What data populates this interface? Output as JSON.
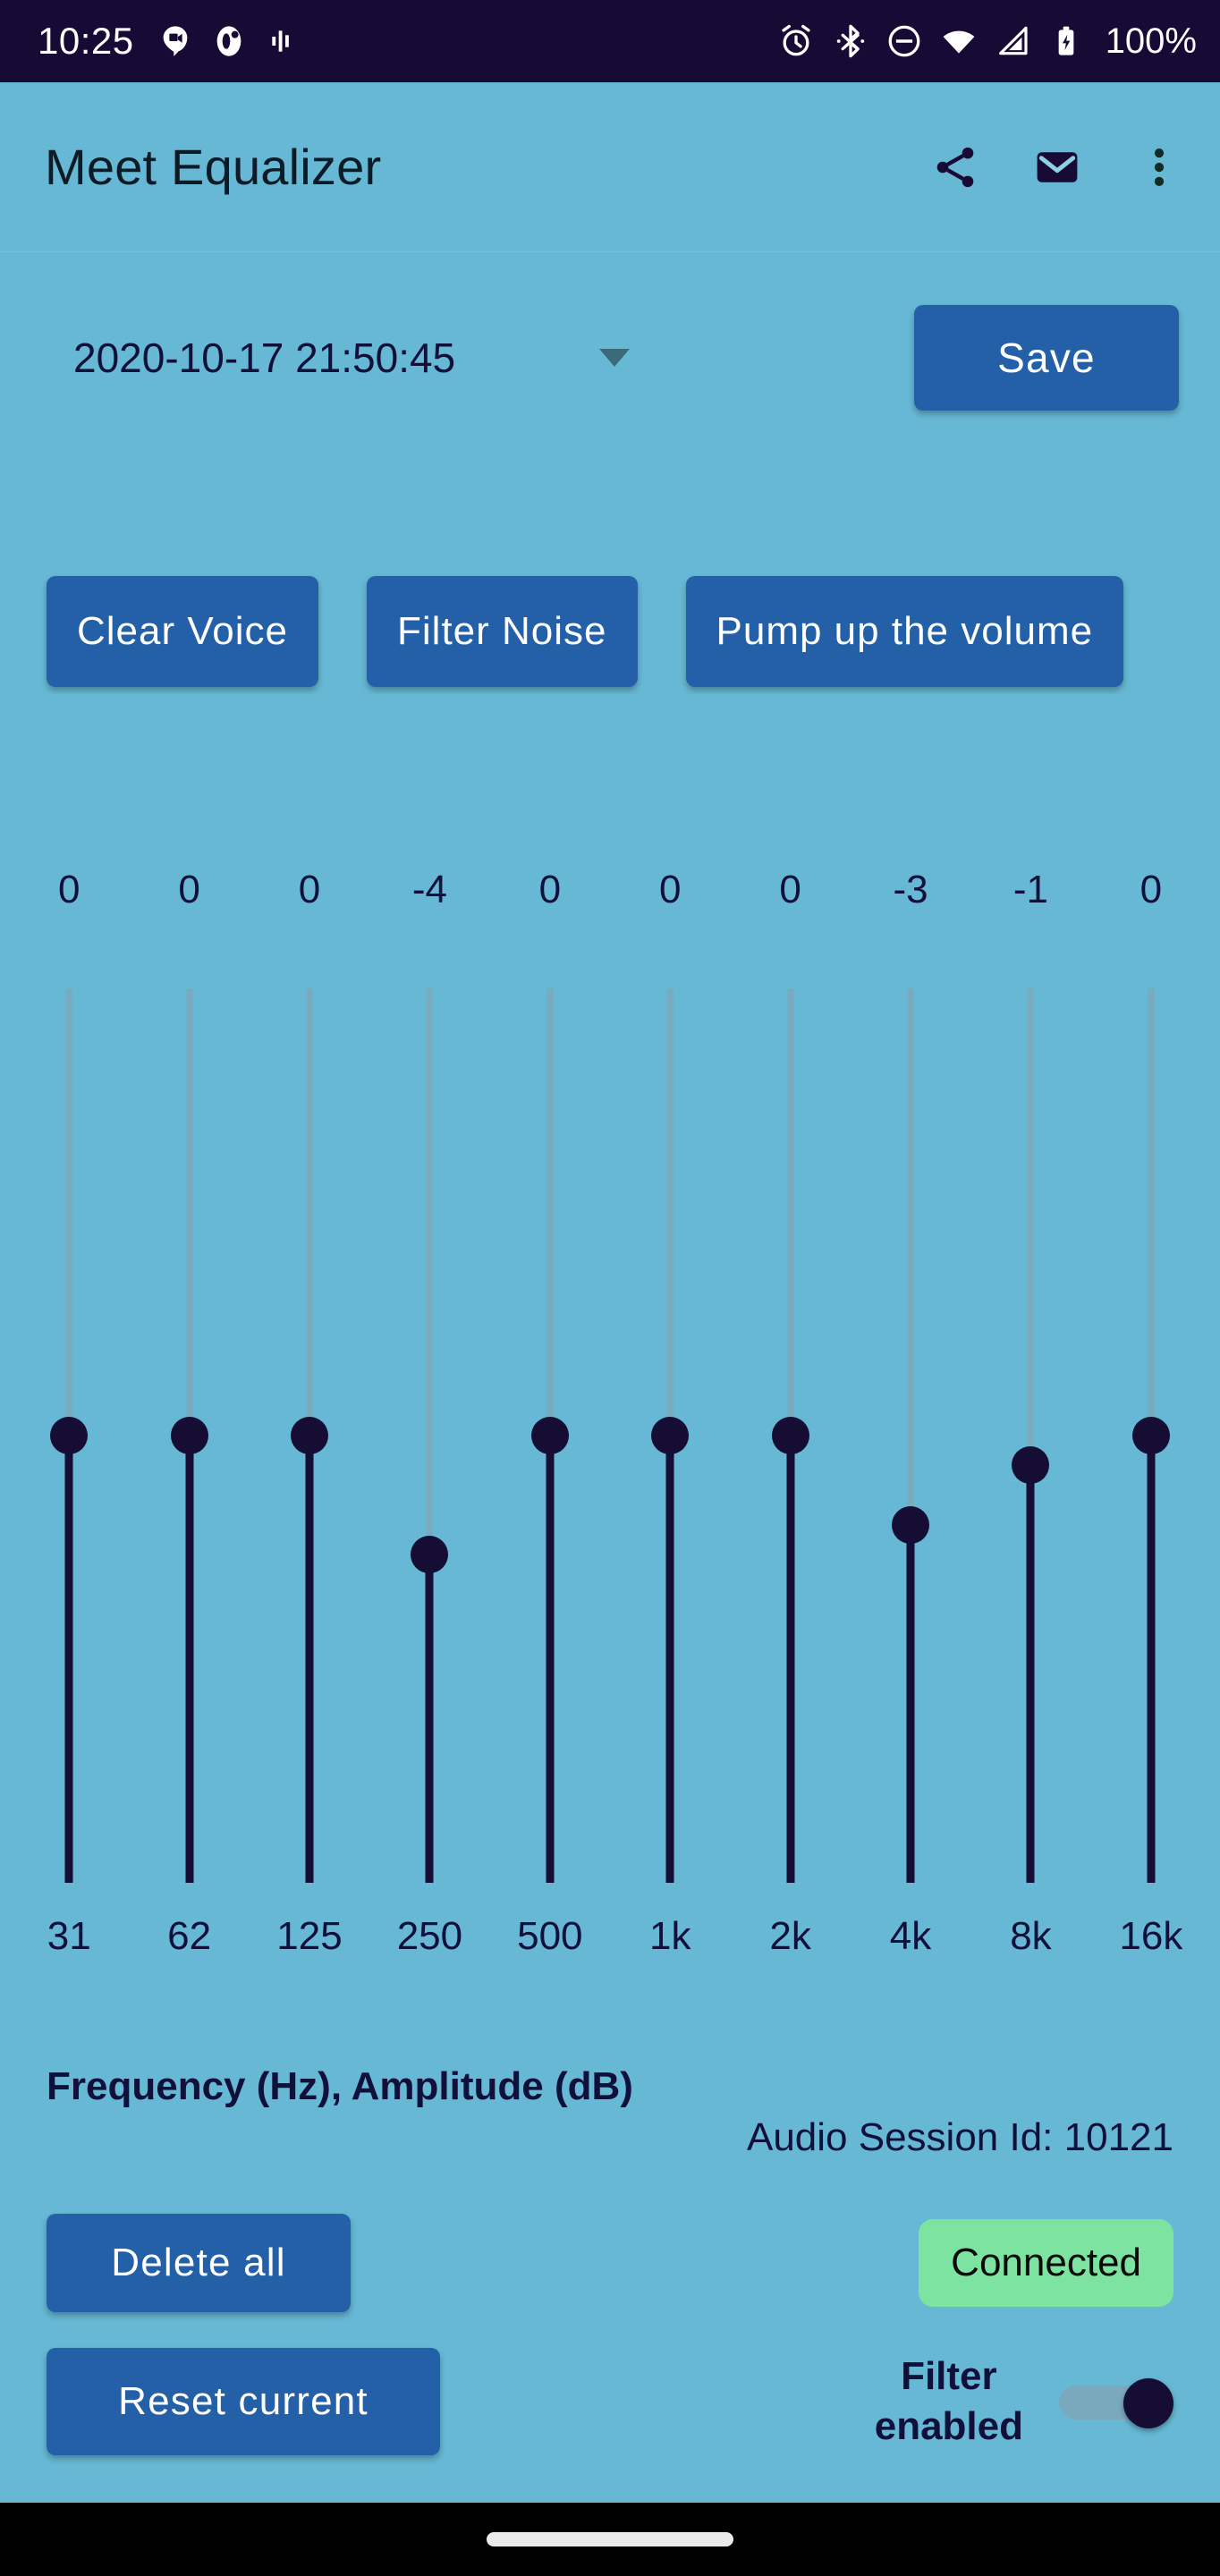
{
  "status_bar": {
    "time": "10:25",
    "battery_text": "100%",
    "left_icons": [
      "meet-icon",
      "app-icon",
      "equalizer-icon"
    ],
    "right_icons": [
      "alarm-icon",
      "bluetooth-icon",
      "do-not-disturb-icon",
      "wifi-icon",
      "cellular-signal-icon",
      "battery-charging-icon"
    ],
    "background_color": "#170a35"
  },
  "app_bar": {
    "title": "Meet Equalizer",
    "actions": [
      "share-icon",
      "email-icon",
      "overflow-menu-icon"
    ],
    "background_color": "#66b8d4"
  },
  "preset_row": {
    "spinner_value": "2020-10-17 21:50:45",
    "save_label": "Save"
  },
  "quick_presets": [
    {
      "label": "Clear Voice"
    },
    {
      "label": "Filter Noise"
    },
    {
      "label": "Pump up the volume"
    }
  ],
  "equalizer": {
    "axis_label": "Frequency (Hz), Amplitude (dB)",
    "session_label": "Audio Session Id: 10121",
    "bands": [
      {
        "freq": "31",
        "value": "0",
        "db": 0
      },
      {
        "freq": "62",
        "value": "0",
        "db": 0
      },
      {
        "freq": "125",
        "value": "0",
        "db": 0
      },
      {
        "freq": "250",
        "value": "-4",
        "db": -4
      },
      {
        "freq": "500",
        "value": "0",
        "db": 0
      },
      {
        "freq": "1k",
        "value": "0",
        "db": 0
      },
      {
        "freq": "2k",
        "value": "0",
        "db": 0
      },
      {
        "freq": "4k",
        "value": "-3",
        "db": -3
      },
      {
        "freq": "8k",
        "value": "-1",
        "db": -1
      },
      {
        "freq": "16k",
        "value": "0",
        "db": 0
      }
    ],
    "db_min": -15,
    "db_max": 15,
    "track_color": "#79aabd",
    "fill_color": "#150d33"
  },
  "footer": {
    "delete_all_label": "Delete all",
    "connected_label": "Connected",
    "connected_color": "#7ce3a0",
    "reset_current_label": "Reset current",
    "filter_switch_label": "Filter\nenabled",
    "filter_switch_on": true
  },
  "theme": {
    "page_background": "#66b8d4",
    "button_color": "#2360a8",
    "text_dark": "#10103a"
  }
}
